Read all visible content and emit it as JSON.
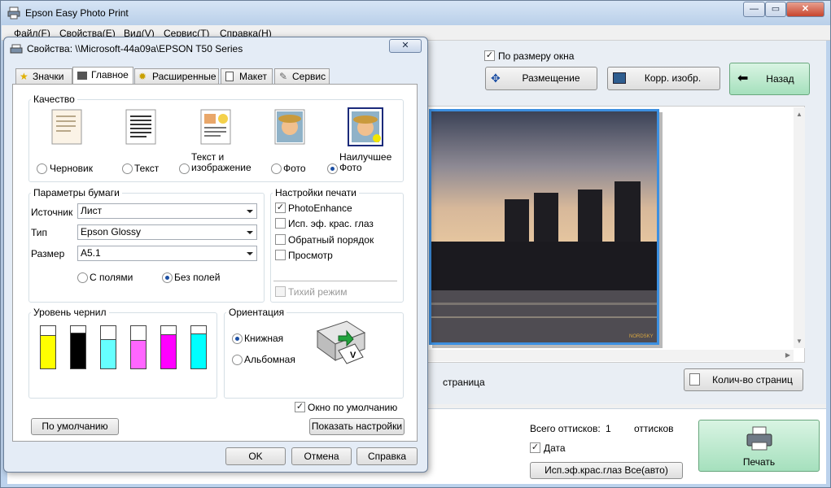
{
  "app": {
    "title": "Epson Easy Photo Print"
  },
  "menu": [
    "Файл(F)",
    "Свойства(E)",
    "Вид(V)",
    "Сервис(T)",
    "Справка(H)"
  ],
  "main": {
    "fit_window": "По размеру окна",
    "btn_layout": "Размещение",
    "btn_correct": "Корр. изобр.",
    "btn_back": "Назад",
    "page_label": "страница",
    "btn_copies": "Колич-во страниц",
    "total_label": "Всего оттисков:",
    "total_value": "1",
    "total_unit": "оттисков",
    "date_label": "Дата",
    "btn_redeye": "Исп.эф.крас.глаз Все(авто)",
    "btn_print": "Печать",
    "photo_watermark": "NORDSKY"
  },
  "dialog": {
    "title": "Свойства: \\\\Microsoft-44a09a\\EPSON T50 Series",
    "tabs": [
      "Значки",
      "Главное",
      "Расширенные",
      "Макет",
      "Сервис"
    ],
    "quality": {
      "label": "Качество",
      "options": [
        "Черновик",
        "Текст",
        "Текст и изображение",
        "Фото",
        "Наилучшее Фото"
      ],
      "selected": 4
    },
    "paper": {
      "label": "Параметры бумаги",
      "source_label": "Источник",
      "source": "Лист",
      "type_label": "Тип",
      "type": "Epson Glossy",
      "size_label": "Размер",
      "size": "A5.1",
      "border": "С полями",
      "borderless": "Без полей"
    },
    "print_settings": {
      "label": "Настройки печати",
      "items": [
        {
          "label": "PhotoEnhance",
          "checked": true
        },
        {
          "label": "Исп. эф. крас. глаз",
          "checked": false
        },
        {
          "label": "Обратный порядок",
          "checked": false
        },
        {
          "label": "Просмотр",
          "checked": false
        }
      ],
      "quiet": "Тихий режим"
    },
    "ink": {
      "label": "Уровень чернил",
      "cartridges": [
        {
          "color": "#ffff00",
          "level": 0.78
        },
        {
          "color": "#000000",
          "level": 0.85
        },
        {
          "color": "#66ffff",
          "level": 0.7
        },
        {
          "color": "#ff66ff",
          "level": 0.68
        },
        {
          "color": "#ff00ff",
          "level": 0.8
        },
        {
          "color": "#00ffff",
          "level": 0.82
        }
      ]
    },
    "orientation": {
      "label": "Ориентация",
      "portrait": "Книжная",
      "landscape": "Альбомная"
    },
    "default_window": "Окно по умолчанию",
    "btn_defaults": "По умолчанию",
    "btn_show": "Показать настройки",
    "btn_ok": "OK",
    "btn_cancel": "Отмена",
    "btn_help": "Справка"
  }
}
